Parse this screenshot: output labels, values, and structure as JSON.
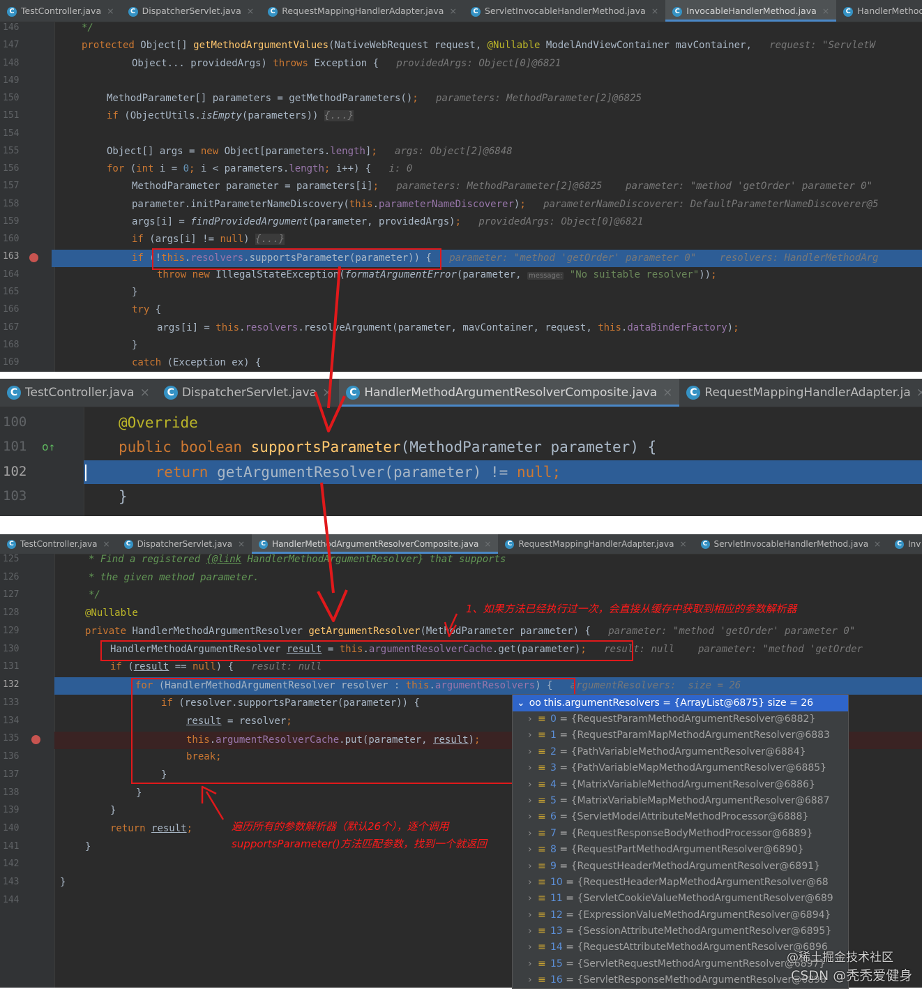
{
  "panel1": {
    "tabs": [
      {
        "label": "TestController.java",
        "active": false
      },
      {
        "label": "DispatcherServlet.java",
        "active": false
      },
      {
        "label": "RequestMappingHandlerAdapter.java",
        "active": false
      },
      {
        "label": "ServletInvocableHandlerMethod.java",
        "active": false
      },
      {
        "label": "InvocableHandlerMethod.java",
        "active": true
      },
      {
        "label": "HandlerMethodArgumentR",
        "active": false
      }
    ],
    "line_numbers": [
      "146",
      "147",
      "148",
      "149",
      "150",
      "151",
      "154",
      "155",
      "156",
      "157",
      "158",
      "159",
      "160",
      "163",
      "164",
      "165",
      "166",
      "167",
      "168",
      "169"
    ]
  },
  "panel2": {
    "tabs": [
      {
        "label": "TestController.java",
        "active": false
      },
      {
        "label": "DispatcherServlet.java",
        "active": false
      },
      {
        "label": "HandlerMethodArgumentResolverComposite.java",
        "active": true
      },
      {
        "label": "RequestMappingHandlerAdapter.ja",
        "active": false
      }
    ],
    "line_numbers": [
      "100",
      "101",
      "102",
      "103"
    ]
  },
  "panel3": {
    "tabs": [
      {
        "label": "TestController.java",
        "active": false
      },
      {
        "label": "DispatcherServlet.java",
        "active": false
      },
      {
        "label": "HandlerMethodArgumentResolverComposite.java",
        "active": true
      },
      {
        "label": "RequestMappingHandlerAdapter.java",
        "active": false
      },
      {
        "label": "ServletInvocableHandlerMethod.java",
        "active": false
      },
      {
        "label": "Inv",
        "active": false
      }
    ],
    "line_numbers": [
      "125",
      "126",
      "127",
      "128",
      "129",
      "130",
      "131",
      "132",
      "133",
      "134",
      "135",
      "136",
      "137",
      "138",
      "139",
      "140",
      "141",
      "142",
      "143",
      "144"
    ]
  },
  "annotations": {
    "note1": "1、如果方法已经执行过一次，会直接从缓存中获取到相应的参数解析器",
    "note2_line1": "遍历所有的参数解析器（默认26个），逐个调用",
    "note2_line2": "supportsParameter()方法匹配参数，找到一个就返回"
  },
  "debugger": {
    "header": "this.argumentResolvers = {ArrayList@6875}  size = 26",
    "items": [
      {
        "index": "0",
        "value": "{RequestParamMethodArgumentResolver@6882}"
      },
      {
        "index": "1",
        "value": "{RequestParamMapMethodArgumentResolver@6883"
      },
      {
        "index": "2",
        "value": "{PathVariableMethodArgumentResolver@6884}"
      },
      {
        "index": "3",
        "value": "{PathVariableMapMethodArgumentResolver@6885}"
      },
      {
        "index": "4",
        "value": "{MatrixVariableMethodArgumentResolver@6886}"
      },
      {
        "index": "5",
        "value": "{MatrixVariableMapMethodArgumentResolver@6887"
      },
      {
        "index": "6",
        "value": "{ServletModelAttributeMethodProcessor@6888}"
      },
      {
        "index": "7",
        "value": "{RequestResponseBodyMethodProcessor@6889}"
      },
      {
        "index": "8",
        "value": "{RequestPartMethodArgumentResolver@6890}"
      },
      {
        "index": "9",
        "value": "{RequestHeaderMethodArgumentResolver@6891}"
      },
      {
        "index": "10",
        "value": "{RequestHeaderMapMethodArgumentResolver@68"
      },
      {
        "index": "11",
        "value": "{ServletCookieValueMethodArgumentResolver@689"
      },
      {
        "index": "12",
        "value": "{ExpressionValueMethodArgumentResolver@6894}"
      },
      {
        "index": "13",
        "value": "{SessionAttributeMethodArgumentResolver@6895}"
      },
      {
        "index": "14",
        "value": "{RequestAttributeMethodArgumentResolver@6896"
      },
      {
        "index": "15",
        "value": "{ServletRequestMethodArgumentResolver@6897}"
      },
      {
        "index": "16",
        "value": "{ServletResponseMethodArgumentResolver@6898"
      }
    ]
  },
  "watermark": {
    "line1": "@稀土掘金技术社区",
    "line2": "CSDN @秃秃爱健身"
  },
  "colors": {
    "editor_bg": "#2b2b2b",
    "execution_line": "#2d5d96",
    "annotation_red": "#e0191b",
    "tab_underline": "#4a88c7"
  }
}
